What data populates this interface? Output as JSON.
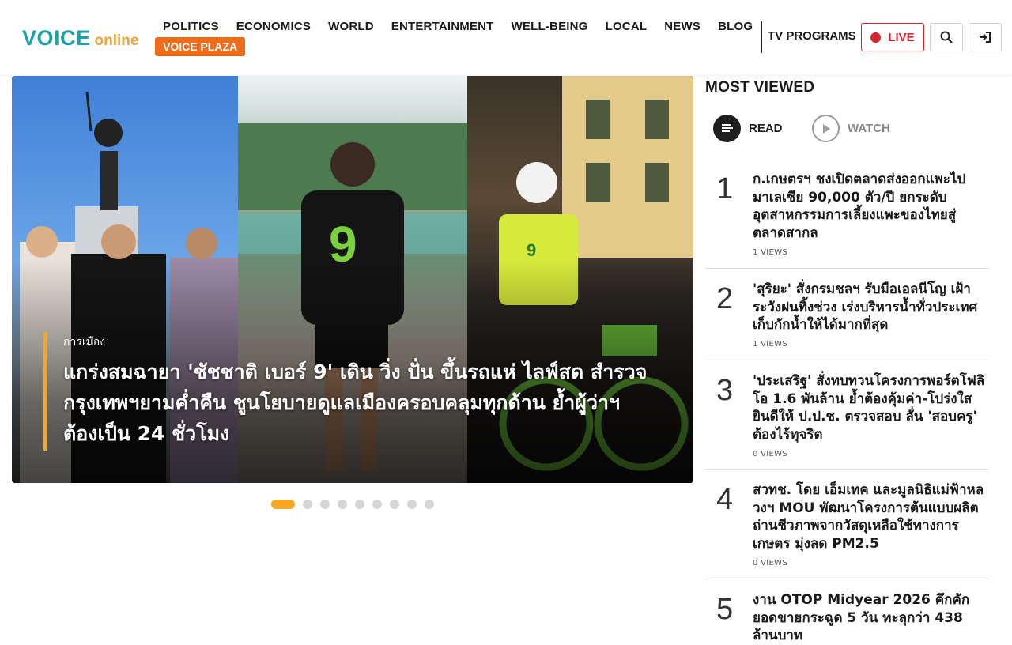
{
  "logo": {
    "voice": "VOICE",
    "online": "online"
  },
  "nav": {
    "items": [
      "POLITICS",
      "ECONOMICS",
      "WORLD",
      "ENTERTAINMENT",
      "WELL-BEING",
      "LOCAL",
      "NEWS",
      "BLOG"
    ],
    "plaza": "VOICE PLAZA",
    "tv_programs": "TV PROGRAMS",
    "live": "LIVE"
  },
  "hero": {
    "category": "การเมือง",
    "title": "แกร่งสมฉายา 'ชัชชาติ เบอร์ 9' เดิน วิ่ง ปั่น ขึ้นรถแห่ ไลฟ์สด สำรวจกรุงเทพฯยามค่ำคืน ชูนโยบายดูแลเมืองครอบคลุมทุกด้าน ย้ำผู้ว่าฯ ต้องเป็น 24 ชั่วโมง",
    "slides": 9,
    "active_slide": 1
  },
  "most_viewed": {
    "title": "MOST VIEWED",
    "tabs": {
      "read": "READ",
      "watch": "WATCH"
    },
    "items": [
      {
        "rank": "1",
        "title": "ก.เกษตรฯ ชงเปิดตลาดส่งออกแพะไปมาเลเซีย 90,000 ตัว/ปี ยกระดับอุตสาหกรรมการเลี้ยงแพะของไทยสู่ตลาดสากล",
        "views": "1 VIEWS"
      },
      {
        "rank": "2",
        "title": "'สุริยะ' สั่งกรมชลฯ รับมือเอลนีโญ เฝ้าระวังฝนทิ้งช่วง เร่งบริหารน้ำทั่วประเทศ เก็บกักน้ำให้ได้มากที่สุด",
        "views": "1 VIEWS"
      },
      {
        "rank": "3",
        "title": "'ประเสริฐ' สั่งทบทวนโครงการพอร์ตโฟลิโอ 1.6 พันล้าน ย้ำต้องคุ้มค่า-โปร่งใส ยินดีให้ ป.ป.ช. ตรวจสอบ ลั่น 'สอบครู' ต้องไร้ทุจริต",
        "views": "0 VIEWS"
      },
      {
        "rank": "4",
        "title": "สวทช. โดย เอ็มเทค และมูลนิธิแม่ฟ้าหลวงฯ MOU พัฒนาโครงการต้นแบบผลิตถ่านชีวภาพจากวัสดุเหลือใช้ทางการเกษตร มุ่งลด PM2.5",
        "views": "0 VIEWS"
      },
      {
        "rank": "5",
        "title": "งาน OTOP Midyear 2026 คึกคัก ยอดขายกระฉูด 5 วัน ทะลุกว่า 438 ล้านบาท",
        "views": ""
      }
    ]
  },
  "colors": {
    "brand_teal": "#1aa2a8",
    "brand_orange": "#ef6c1b",
    "accent_yellow": "#f5a623",
    "live_red": "#d9232b"
  }
}
